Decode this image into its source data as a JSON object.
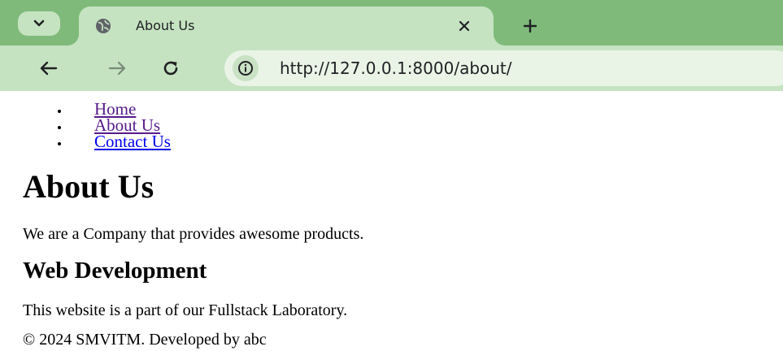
{
  "browser": {
    "tab": {
      "title": "About Us",
      "favicon": "globe-icon"
    },
    "tab_search_icon": "chevron-down-icon",
    "close_icon": "close-icon",
    "new_tab_icon": "plus-icon",
    "toolbar": {
      "back_icon": "arrow-left-icon",
      "forward_icon": "arrow-right-icon",
      "reload_icon": "reload-icon",
      "site_info_icon": "info-icon",
      "url": "http://127.0.0.1:8000/about/"
    },
    "colors": {
      "frame": "#7fba7a",
      "active_tab": "#c5e3c1",
      "omnibox": "#e9f4e6"
    }
  },
  "page": {
    "nav": [
      {
        "label": "Home"
      },
      {
        "label": "About Us"
      },
      {
        "label": "Contact Us"
      }
    ],
    "heading": "About Us",
    "intro": "We are a Company that provides awesome products.",
    "subheading": "Web Development",
    "body": "This website is a part of our Fullstack Laboratory.",
    "footer": "© 2024 SMVITM. Developed by abc"
  }
}
